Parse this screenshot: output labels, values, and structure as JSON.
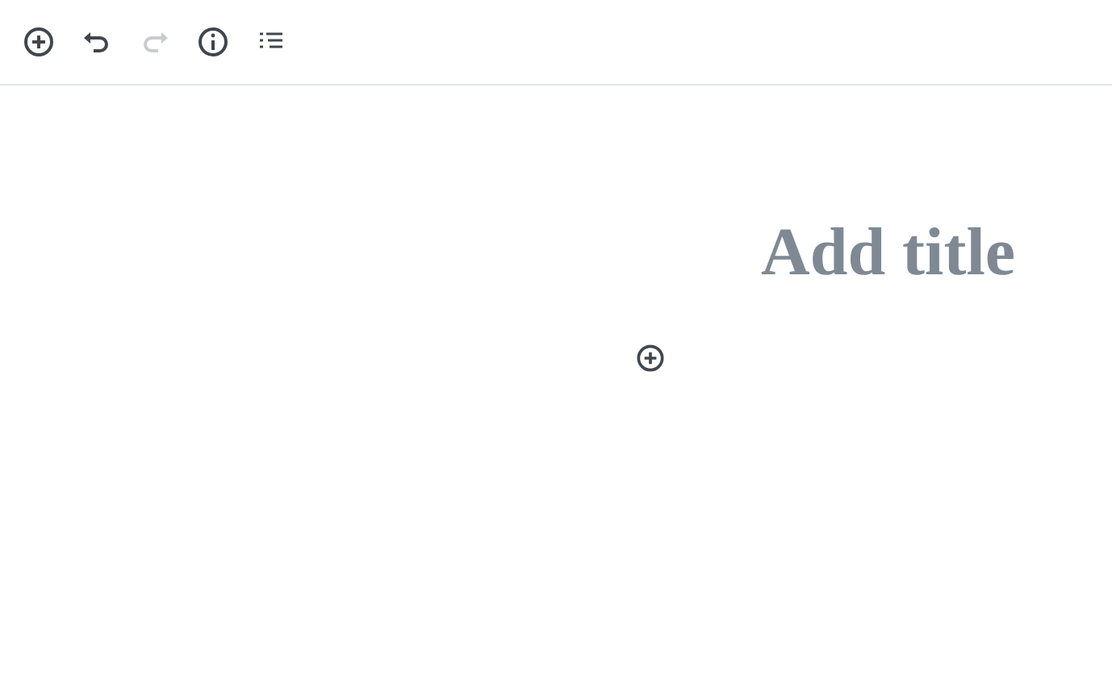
{
  "toolbar": {
    "buttons": [
      {
        "kind": "add",
        "disabled": false
      },
      {
        "kind": "undo",
        "disabled": false
      },
      {
        "kind": "redo",
        "disabled": true
      },
      {
        "kind": "info",
        "disabled": false
      },
      {
        "kind": "outline",
        "disabled": false
      }
    ]
  },
  "editor": {
    "title": {
      "placeholder": "Add title"
    },
    "inserter": {
      "kind": "add"
    }
  }
}
